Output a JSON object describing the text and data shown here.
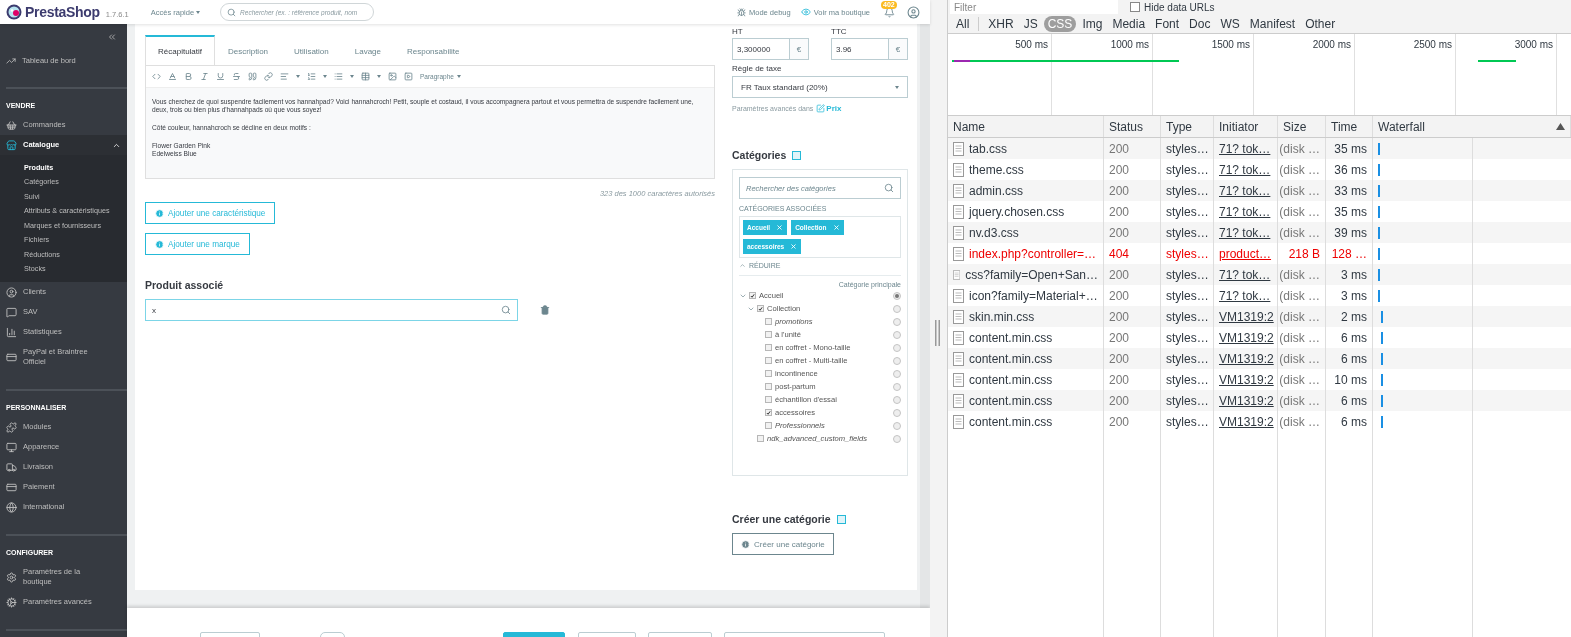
{
  "header": {
    "logo": "PrestaShop",
    "version": "1.7.6.1",
    "quick_access": "Accès rapide",
    "search": {
      "placeholder": "Rechercher (ex. : référence produit, nom"
    },
    "debug": "Mode debug",
    "view_shop": "Voir ma boutique",
    "notifications": "402"
  },
  "sidebar": {
    "dashboard": "Tableau de bord",
    "sections": [
      {
        "title": "VENDRE",
        "items": [
          {
            "label": "Commandes",
            "selected": false,
            "expanded": false
          },
          {
            "label": "Catalogue",
            "selected": true,
            "expanded": true,
            "children": [
              {
                "label": "Produits",
                "selected": true
              },
              {
                "label": "Catégories",
                "selected": false
              },
              {
                "label": "Suivi",
                "selected": false
              },
              {
                "label": "Attributs & caractéristiques",
                "selected": false
              },
              {
                "label": "Marques et fournisseurs",
                "selected": false
              },
              {
                "label": "Fichiers",
                "selected": false
              },
              {
                "label": "Réductions",
                "selected": false
              },
              {
                "label": "Stocks",
                "selected": false
              }
            ]
          },
          {
            "label": "Clients",
            "selected": false,
            "expanded": false
          },
          {
            "label": "SAV",
            "selected": false,
            "expanded": false
          },
          {
            "label": "Statistiques",
            "selected": false,
            "expanded": false
          },
          {
            "label": "PayPal et Braintree Officiel",
            "selected": false,
            "expanded": false
          }
        ]
      },
      {
        "title": "PERSONNALISER",
        "items": [
          {
            "label": "Modules",
            "selected": false,
            "expanded": false
          },
          {
            "label": "Apparence",
            "selected": false,
            "expanded": false
          },
          {
            "label": "Livraison",
            "selected": false,
            "expanded": false
          },
          {
            "label": "Paiement",
            "selected": false,
            "expanded": false
          },
          {
            "label": "International",
            "selected": false,
            "expanded": false
          }
        ]
      },
      {
        "title": "CONFIGURER",
        "items": [
          {
            "label": "Paramètres de la boutique",
            "selected": false,
            "expanded": false
          },
          {
            "label": "Paramètres avancés",
            "selected": false,
            "expanded": false
          }
        ]
      }
    ]
  },
  "editor": {
    "tabs": [
      {
        "label": "Récapitulatif",
        "selected": true
      },
      {
        "label": "Description",
        "selected": false
      },
      {
        "label": "Utilisation",
        "selected": false
      },
      {
        "label": "Lavage",
        "selected": false
      },
      {
        "label": "Responsabilite",
        "selected": false
      }
    ],
    "format": "Paragraphe",
    "paragraphs": [
      [
        "Vous cherchez de quoi suspendre facilement vos hannahpad? Voici hannahcroch! Petit, souple et costaud, il vous accompagnera partout et vous permettra de suspendre facilement une, deux, trois ou bien plus d'hannahpads où que vous soyez!"
      ],
      [
        "Côté couleur, hannahcroch se décline en deux motifs :"
      ],
      [
        "Flower Garden Pink",
        "Edelweiss Blue"
      ]
    ],
    "counter": "323 des 1000 caractères autorisés"
  },
  "actions": [
    "Ajouter une caractéristique",
    "Ajouter une marque"
  ],
  "related": {
    "title": "Produit associé",
    "search": {
      "value": "x"
    }
  },
  "price": {
    "ht_label": "HT",
    "ttc_label": "TTC",
    "ht": {
      "value": "3,300000",
      "currency": "€"
    },
    "ttc": {
      "value": "3.96",
      "currency": "€"
    },
    "tax_label": "Règle de taxe",
    "tax_rule": "FR Taux standard (20%)",
    "advanced_text": "Paramètres avancés dans",
    "advanced_link": "Prix"
  },
  "categories": {
    "title": "Catégories",
    "search": {
      "placeholder": "Rechercher des catégories"
    },
    "associated_label": "CATÉGORIES ASSOCIÉES",
    "tags": [
      "Accueil",
      "Collection",
      "accessoires"
    ],
    "collapse": "RÉDUIRE",
    "main_label": "Catégorie principale",
    "tree": [
      {
        "label": "Accueil",
        "checked": true,
        "expanded": true,
        "main": true,
        "inactive": false,
        "children": [
          {
            "label": "Collection",
            "checked": true,
            "expanded": true,
            "main": false,
            "inactive": false,
            "children": [
              {
                "label": "promotions",
                "checked": false,
                "expanded": false,
                "main": false,
                "inactive": true
              },
              {
                "label": "à l'unité",
                "checked": false,
                "expanded": false,
                "main": false,
                "inactive": false
              },
              {
                "label": "en coffret - Mono-taille",
                "checked": false,
                "expanded": false,
                "main": false,
                "inactive": false
              },
              {
                "label": "en coffret - Multi-taille",
                "checked": false,
                "expanded": false,
                "main": false,
                "inactive": false
              },
              {
                "label": "incontinence",
                "checked": false,
                "expanded": false,
                "main": false,
                "inactive": false
              },
              {
                "label": "post-partum",
                "checked": false,
                "expanded": false,
                "main": false,
                "inactive": false
              },
              {
                "label": "échantillon d'essai",
                "checked": false,
                "expanded": false,
                "main": false,
                "inactive": false
              },
              {
                "label": "accessoires",
                "checked": true,
                "expanded": false,
                "main": false,
                "inactive": false
              },
              {
                "label": "Professionnels",
                "checked": false,
                "expanded": false,
                "main": false,
                "inactive": true
              }
            ]
          },
          {
            "label": "ndk_advanced_custom_fields",
            "checked": false,
            "expanded": false,
            "main": false,
            "inactive": true
          }
        ]
      }
    ]
  },
  "create_category": {
    "title": "Créer une catégorie",
    "button": "Créer une catégorie"
  },
  "footer": {
    "buttons": [
      {
        "kind": "outline"
      },
      {
        "kind": "toggle"
      },
      {
        "kind": "primary"
      },
      {
        "kind": "outline"
      },
      {
        "kind": "outline"
      },
      {
        "kind": "outline"
      }
    ]
  },
  "devtools": {
    "filter": {
      "placeholder": "Filter"
    },
    "hide_data_urls": {
      "label": "Hide data URLs",
      "checked": false
    },
    "types": [
      {
        "label": "All",
        "selected": false
      },
      {
        "label": "XHR",
        "selected": false
      },
      {
        "label": "JS",
        "selected": false
      },
      {
        "label": "CSS",
        "selected": true
      },
      {
        "label": "Img",
        "selected": false
      },
      {
        "label": "Media",
        "selected": false
      },
      {
        "label": "Font",
        "selected": false
      },
      {
        "label": "Doc",
        "selected": false
      },
      {
        "label": "WS",
        "selected": false
      },
      {
        "label": "Manifest",
        "selected": false
      },
      {
        "label": "Other",
        "selected": false
      }
    ],
    "overview": {
      "ticks": [
        "500 ms",
        "1000 ms",
        "1500 ms",
        "2000 ms",
        "2500 ms",
        "3000 ms"
      ]
    },
    "columns": [
      "Name",
      "Status",
      "Type",
      "Initiator",
      "Size",
      "Time",
      "Waterfall"
    ],
    "rows": [
      {
        "name": "tab.css",
        "status": "200",
        "type": "styles…",
        "initiator": "71? tok…",
        "size": "(disk …",
        "time": "35 ms",
        "failed": false
      },
      {
        "name": "theme.css",
        "status": "200",
        "type": "styles…",
        "initiator": "71? tok…",
        "size": "(disk …",
        "time": "36 ms",
        "failed": false
      },
      {
        "name": "admin.css",
        "status": "200",
        "type": "styles…",
        "initiator": "71? tok…",
        "size": "(disk …",
        "time": "33 ms",
        "failed": false
      },
      {
        "name": "jquery.chosen.css",
        "status": "200",
        "type": "styles…",
        "initiator": "71? tok…",
        "size": "(disk …",
        "time": "35 ms",
        "failed": false
      },
      {
        "name": "nv.d3.css",
        "status": "200",
        "type": "styles…",
        "initiator": "71? tok…",
        "size": "(disk …",
        "time": "39 ms",
        "failed": false
      },
      {
        "name": "index.php?controller=…",
        "status": "404",
        "type": "styles…",
        "initiator": "product…",
        "size": "218 B",
        "time": "128 …",
        "failed": true
      },
      {
        "name": "css?family=Open+San…",
        "status": "200",
        "type": "styles…",
        "initiator": "71? tok…",
        "size": "(disk …",
        "time": "3 ms",
        "failed": false
      },
      {
        "name": "icon?family=Material+…",
        "status": "200",
        "type": "styles…",
        "initiator": "71? tok…",
        "size": "(disk …",
        "time": "3 ms",
        "failed": false
      },
      {
        "name": "skin.min.css",
        "status": "200",
        "type": "styles…",
        "initiator": "VM1319:2",
        "size": "(disk …",
        "time": "2 ms",
        "failed": false
      },
      {
        "name": "content.min.css",
        "status": "200",
        "type": "styles…",
        "initiator": "VM1319:2",
        "size": "(disk …",
        "time": "6 ms",
        "failed": false
      },
      {
        "name": "content.min.css",
        "status": "200",
        "type": "styles…",
        "initiator": "VM1319:2",
        "size": "(disk …",
        "time": "6 ms",
        "failed": false
      },
      {
        "name": "content.min.css",
        "status": "200",
        "type": "styles…",
        "initiator": "VM1319:2",
        "size": "(disk …",
        "time": "10 ms",
        "failed": false
      },
      {
        "name": "content.min.css",
        "status": "200",
        "type": "styles…",
        "initiator": "VM1319:2",
        "size": "(disk …",
        "time": "6 ms",
        "failed": false
      },
      {
        "name": "content.min.css",
        "status": "200",
        "type": "styles…",
        "initiator": "VM1319:2",
        "size": "(disk …",
        "time": "6 ms",
        "failed": false
      }
    ]
  }
}
